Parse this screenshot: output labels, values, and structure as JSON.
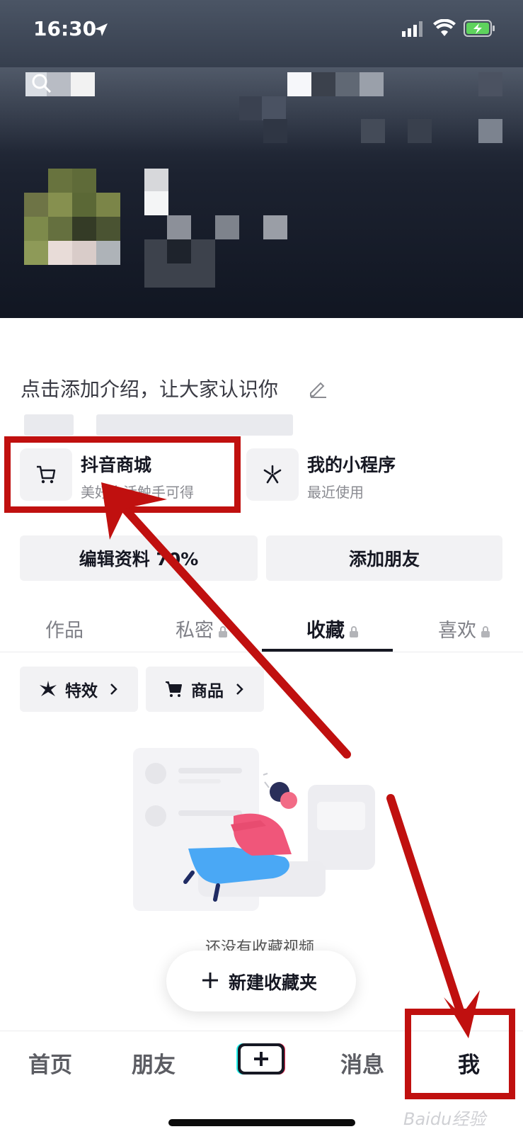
{
  "status_bar": {
    "time": "16:30"
  },
  "profile": {
    "intro": "点击添加介绍，让大家认识你"
  },
  "entries": [
    {
      "title": "抖音商城",
      "subtitle": "美好生活触手可得",
      "icon": "cart-icon"
    },
    {
      "title": "我的小程序",
      "subtitle": "最近使用",
      "icon": "mini-program-icon"
    }
  ],
  "actions": {
    "edit_profile": "编辑资料 70%",
    "add_friends": "添加朋友"
  },
  "tabs": [
    {
      "label": "作品",
      "locked": false
    },
    {
      "label": "私密",
      "locked": true
    },
    {
      "label": "收藏",
      "locked": true,
      "active": true
    },
    {
      "label": "喜欢",
      "locked": true
    }
  ],
  "filters": [
    {
      "label": "特效",
      "icon": "effects-icon"
    },
    {
      "label": "商品",
      "icon": "cart-icon"
    }
  ],
  "empty_state": {
    "text": "还没有收藏视频"
  },
  "new_folder": {
    "label": "新建收藏夹"
  },
  "bottom_nav": {
    "home": "首页",
    "friends": "朋友",
    "messages": "消息",
    "me": "我",
    "active": "我"
  },
  "watermark": "Baidu经验",
  "colors": {
    "annotation_red": "#c0100f",
    "text_primary": "#161823",
    "chip_bg": "#f2f2f4"
  }
}
